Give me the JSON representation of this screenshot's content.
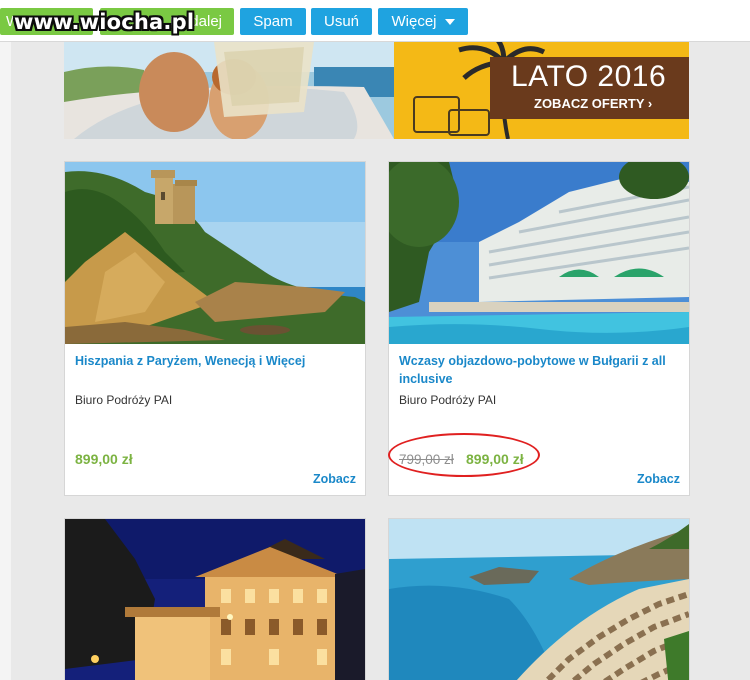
{
  "toolbar": {
    "btn_left_fragment": "W",
    "btn_forward_partial": "dalej",
    "btn_spam": "Spam",
    "btn_delete": "Usuń",
    "btn_more": "Więcej"
  },
  "watermark": "www.wiocha.pl",
  "banner": {
    "title": "LATO 2016",
    "subtitle": "ZOBACZ OFERTY ›"
  },
  "offers": [
    {
      "title": "Hiszpania z Paryżem, Wenecją i Więcej",
      "agency": "Biuro Podróży PAI",
      "price": "899,00 zł",
      "cta": "Zobacz"
    },
    {
      "title": "Wczasy objazdowo-pobytowe w Bułgarii z all inclusive",
      "agency": "Biuro Podróży PAI",
      "old_price": "799,00 zł",
      "price": "899,00 zł",
      "cta": "Zobacz"
    },
    {},
    {}
  ],
  "colors": {
    "toolbar_green": "#7ac943",
    "toolbar_blue": "#1fa3e0",
    "link_blue": "#1a88c9",
    "price_green": "#7cb342",
    "annotation_red": "#e02020",
    "banner_yellow": "#f4b916"
  }
}
